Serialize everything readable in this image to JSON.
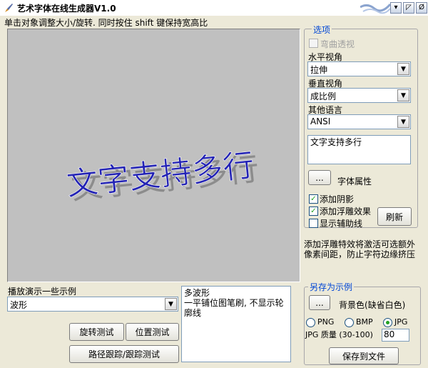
{
  "window": {
    "title": "艺术字体在线生成器V1.0",
    "hint": "单击对象调整大小/旋转. 同时按住 shift 键保持宽高比",
    "min_symbol": "▾",
    "max_symbol": "◸",
    "close_symbol": "Ø"
  },
  "canvas": {
    "art_text": "文字支持多行",
    "bg_color": "#c0c0c0",
    "text_color": "#2323b4",
    "shadow_color": "#8c8c8c"
  },
  "options": {
    "legend": "选项",
    "curve_label": "弯曲透视",
    "curve_checked": false,
    "horizontal_label": "水平视角",
    "horizontal_value": "拉伸",
    "vertical_label": "垂直视角",
    "vertical_value": "成比例",
    "language_label": "其他语言",
    "language_value": "ANSI",
    "text_value": "文字支持多行",
    "font_button": "...",
    "font_label": "字体属性",
    "shadow_label": "添加阴影",
    "shadow_checked": true,
    "emboss_label": "添加浮雕效果",
    "emboss_checked": true,
    "guide_label": "显示辅助线",
    "guide_checked": false,
    "refresh_label": "刷新"
  },
  "emboss_note": {
    "line1": "添加浮雕特效将激活可选额外",
    "line2": "像素间距，防止字符边缘挤压"
  },
  "demo": {
    "label": "播放演示一些示例",
    "selected": "波形",
    "desc_title": "多波形",
    "desc_body": "一平铺位图笔刷, 不显示轮廓线",
    "rotate_button": "旋转测试",
    "position_button": "位置测试",
    "path_button": "路径跟踪/跟踪测试"
  },
  "save": {
    "legend": "另存为示例",
    "bg_button": "...",
    "bg_label": "背景色(缺省白色)",
    "format_png": "PNG",
    "format_bmp": "BMP",
    "format_jpg": "JPG",
    "selected_format": "JPG",
    "quality_label": "JPG 质量 (30-100)",
    "quality_value": "80",
    "save_button": "保存到文件"
  },
  "icons": {
    "check_mark": "✓",
    "dropdown_arrow": "▼"
  }
}
